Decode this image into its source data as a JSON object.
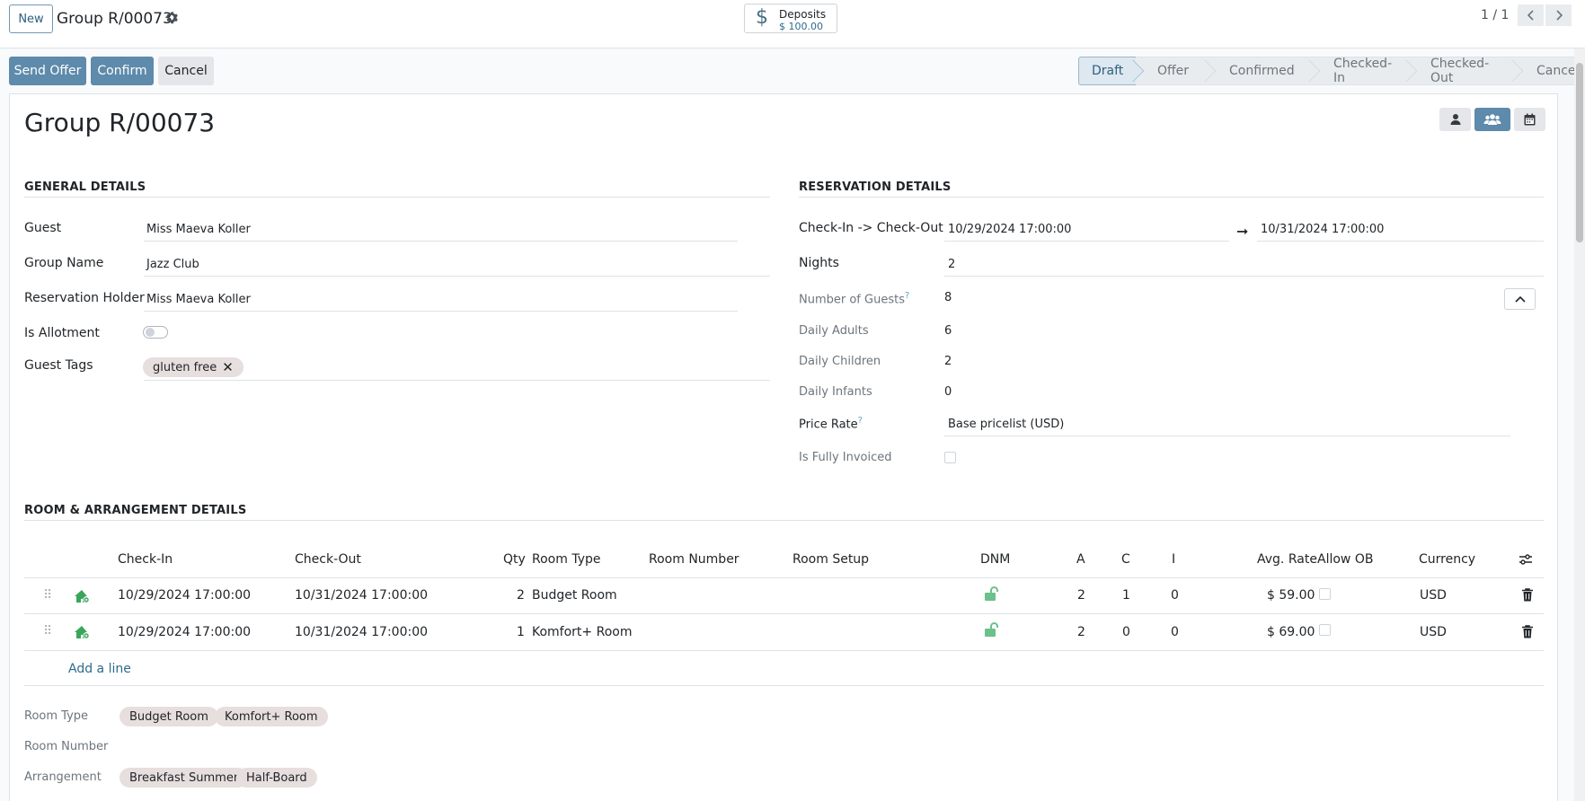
{
  "topbar": {
    "new_label": "New",
    "breadcrumb": "Group R/00073",
    "deposits_label": "Deposits",
    "deposits_value": "$ 100.00",
    "pager": "1 / 1"
  },
  "actions": {
    "send_offer": "Send Offer",
    "confirm": "Confirm",
    "cancel": "Cancel"
  },
  "stages": [
    "Draft",
    "Offer",
    "Confirmed",
    "Checked-In",
    "Checked-Out",
    "Cancelled"
  ],
  "active_stage": "Draft",
  "record": {
    "title": "Group R/00073"
  },
  "general": {
    "heading": "GENERAL DETAILS",
    "guest_label": "Guest",
    "guest_value": "Miss Maeva Koller",
    "group_name_label": "Group Name",
    "group_name_value": "Jazz Club",
    "holder_label": "Reservation Holder",
    "holder_value": "Miss Maeva Koller",
    "allotment_label": "Is Allotment",
    "tags_label": "Guest Tags",
    "tag_value": "gluten free"
  },
  "reservation": {
    "heading": "RESERVATION DETAILS",
    "checkin_label": "Check-In -> Check-Out",
    "checkin_value": "10/29/2024 17:00:00",
    "checkout_value": "10/31/2024 17:00:00",
    "nights_label": "Nights",
    "nights_value": "2",
    "guests_label": "Number of Guests",
    "guests_value": "8",
    "adults_label": "Daily Adults",
    "adults_value": "6",
    "children_label": "Daily Children",
    "children_value": "2",
    "infants_label": "Daily Infants",
    "infants_value": "0",
    "price_label": "Price Rate",
    "price_value": "Base pricelist (USD)",
    "invoiced_label": "Is Fully Invoiced"
  },
  "rooms": {
    "heading": "ROOM & ARRANGEMENT DETAILS",
    "columns": {
      "checkin": "Check-In",
      "checkout": "Check-Out",
      "qty": "Qty",
      "room_type": "Room Type",
      "room_number": "Room Number",
      "room_setup": "Room Setup",
      "dnm": "DNM",
      "a": "A",
      "c": "C",
      "i": "I",
      "avg_rate": "Avg. Rate",
      "allow_ob": "Allow OB",
      "currency": "Currency"
    },
    "rows": [
      {
        "checkin": "10/29/2024 17:00:00",
        "checkout": "10/31/2024 17:00:00",
        "qty": "2",
        "room_type": "Budget Room",
        "a": "2",
        "c": "1",
        "i": "0",
        "avg_rate": "$ 59.00",
        "currency": "USD"
      },
      {
        "checkin": "10/29/2024 17:00:00",
        "checkout": "10/31/2024 17:00:00",
        "qty": "1",
        "room_type": "Komfort+ Room",
        "a": "2",
        "c": "0",
        "i": "0",
        "avg_rate": "$ 69.00",
        "currency": "USD"
      }
    ],
    "add_line": "Add a line"
  },
  "summary": {
    "room_type_label": "Room Type",
    "room_type_tags": [
      "Budget Room",
      "Komfort+ Room"
    ],
    "room_number_label": "Room Number",
    "arrangement_label": "Arrangement",
    "arrangement_tags": [
      "Breakfast Summer",
      "Half-Board"
    ]
  },
  "colors": {
    "primary": "#5e8aab",
    "accent_green": "#3aa65c",
    "tag_bg": "#e7dede"
  }
}
